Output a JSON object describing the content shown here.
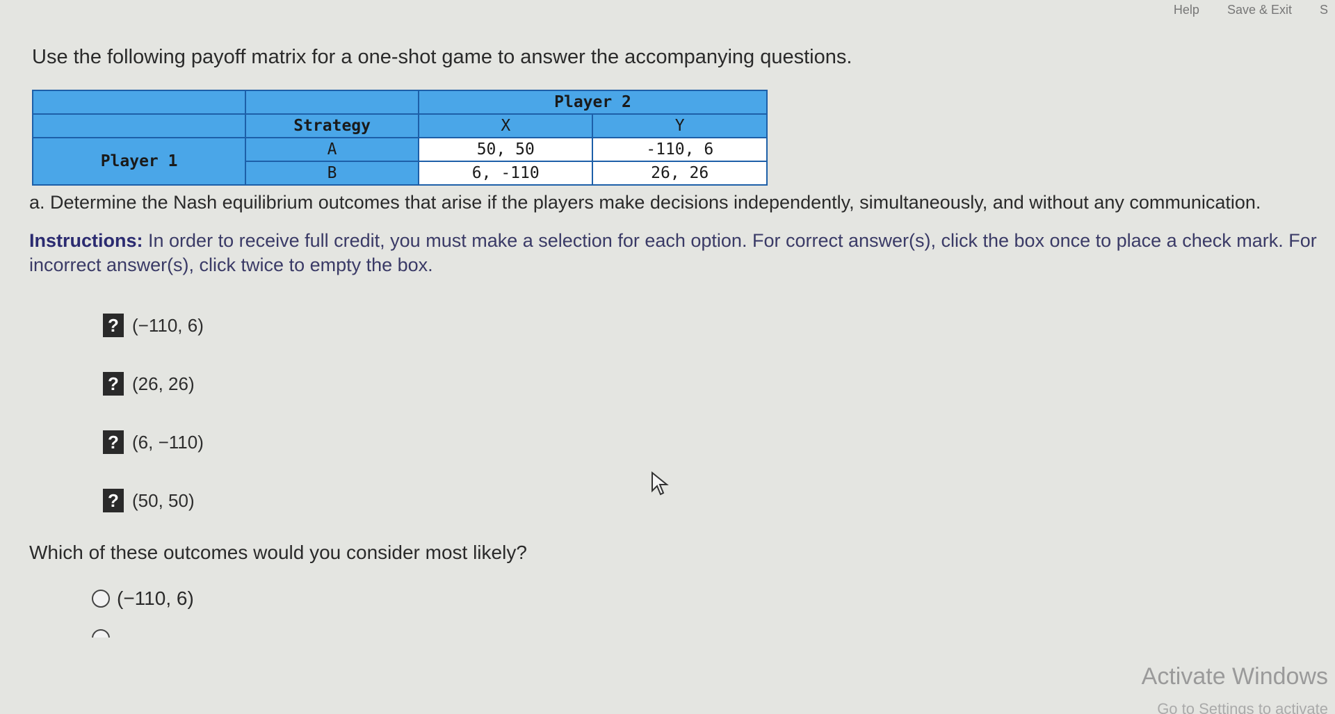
{
  "topbar": {
    "help": "Help",
    "save_exit": "Save & Exit",
    "submit_partial": "S"
  },
  "intro": "Use the following payoff matrix for a one-shot game to answer the accompanying questions.",
  "matrix": {
    "player2": "Player 2",
    "player1": "Player 1",
    "strategy": "Strategy",
    "col_x": "X",
    "col_y": "Y",
    "row_a": "A",
    "row_b": "B",
    "a_x": "50, 50",
    "a_y": "-110, 6",
    "b_x": "6, -110",
    "b_y": "26, 26"
  },
  "question_a": "a. Determine the Nash equilibrium outcomes that arise if the players make decisions independently, simultaneously, and without any communication.",
  "instructions": {
    "label": "Instructions:",
    "text": " In order to receive full credit, you must make a selection for each option. For correct answer(s), click the box once to place a check mark. For incorrect answer(s), click twice to empty the box."
  },
  "checkboxes": [
    {
      "mark": "?",
      "label": "(−110, 6)"
    },
    {
      "mark": "?",
      "label": "(26, 26)"
    },
    {
      "mark": "?",
      "label": "(6, −110)"
    },
    {
      "mark": "?",
      "label": "(50, 50)"
    }
  ],
  "question_b": "Which of these outcomes would you consider most likely?",
  "radios": [
    {
      "label": "(−110, 6)"
    }
  ],
  "watermark": {
    "title": "Activate Windows",
    "sub": "Go to Settings to activate"
  }
}
